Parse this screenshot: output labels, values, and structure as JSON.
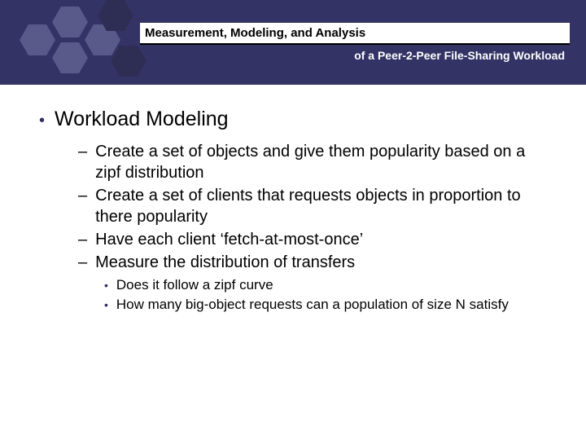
{
  "header": {
    "title": "Measurement, Modeling, and Analysis",
    "subtitle": "of a Peer-2-Peer File-Sharing Workload"
  },
  "main": {
    "heading": "Workload Modeling",
    "items": [
      "Create a set of objects and give them popularity based on a zipf distribution",
      "Create a set of clients that requests objects in proportion to there popularity",
      "Have each client ‘fetch-at-most-once’",
      "Measure the distribution of transfers"
    ],
    "subitems": [
      "Does it follow a zipf curve",
      "How many big-object requests can a population of size N satisfy"
    ]
  }
}
